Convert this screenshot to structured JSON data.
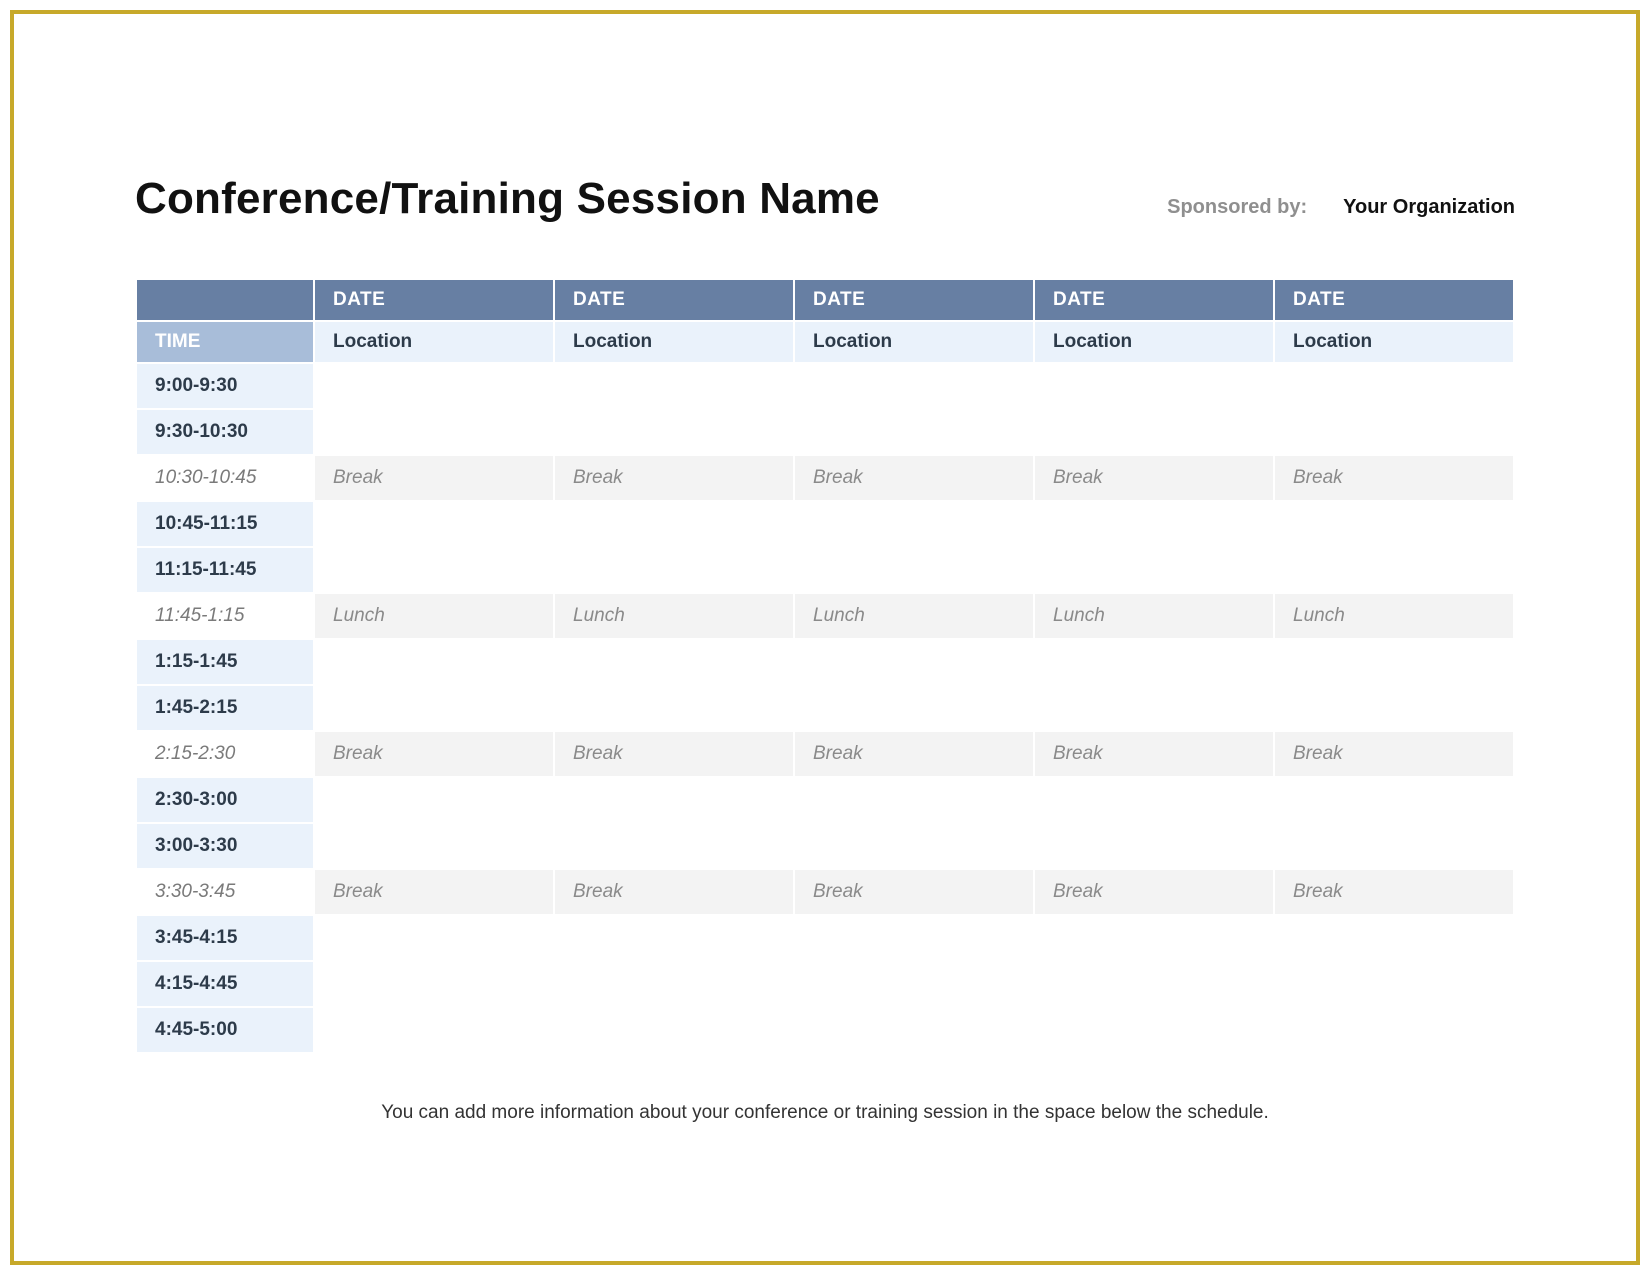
{
  "header": {
    "title": "Conference/Training Session Name",
    "sponsor_label": "Sponsored by:",
    "sponsor_org": "Your Organization"
  },
  "table": {
    "time_header": "TIME",
    "date_header": "DATE",
    "location_sub": "Location",
    "num_columns": 5,
    "rows": [
      {
        "time": "9:00-9:30",
        "type": "plain",
        "cells": [
          "",
          "",
          "",
          "",
          ""
        ]
      },
      {
        "time": "9:30-10:30",
        "type": "plain",
        "cells": [
          "",
          "",
          "",
          "",
          ""
        ]
      },
      {
        "time": "10:30-10:45",
        "type": "break",
        "cells": [
          "Break",
          "Break",
          "Break",
          "Break",
          "Break"
        ]
      },
      {
        "time": "10:45-11:15",
        "type": "plain",
        "cells": [
          "",
          "",
          "",
          "",
          ""
        ]
      },
      {
        "time": "11:15-11:45",
        "type": "plain",
        "cells": [
          "",
          "",
          "",
          "",
          ""
        ]
      },
      {
        "time": "11:45-1:15",
        "type": "break",
        "cells": [
          "Lunch",
          "Lunch",
          "Lunch",
          "Lunch",
          "Lunch"
        ]
      },
      {
        "time": "1:15-1:45",
        "type": "plain",
        "cells": [
          "",
          "",
          "",
          "",
          ""
        ]
      },
      {
        "time": "1:45-2:15",
        "type": "plain",
        "cells": [
          "",
          "",
          "",
          "",
          ""
        ]
      },
      {
        "time": "2:15-2:30",
        "type": "break",
        "cells": [
          "Break",
          "Break",
          "Break",
          "Break",
          "Break"
        ]
      },
      {
        "time": "2:30-3:00",
        "type": "plain",
        "cells": [
          "",
          "",
          "",
          "",
          ""
        ]
      },
      {
        "time": "3:00-3:30",
        "type": "plain",
        "cells": [
          "",
          "",
          "",
          "",
          ""
        ]
      },
      {
        "time": "3:30-3:45",
        "type": "break",
        "cells": [
          "Break",
          "Break",
          "Break",
          "Break",
          "Break"
        ]
      },
      {
        "time": "3:45-4:15",
        "type": "plain",
        "cells": [
          "",
          "",
          "",
          "",
          ""
        ]
      },
      {
        "time": "4:15-4:45",
        "type": "plain",
        "cells": [
          "",
          "",
          "",
          "",
          ""
        ]
      },
      {
        "time": "4:45-5:00",
        "type": "plain",
        "cells": [
          "",
          "",
          "",
          "",
          ""
        ]
      }
    ]
  },
  "footer": {
    "note": "You can add more information about your conference or training session in the space below the schedule."
  },
  "colors": {
    "frame": "#c7a92a",
    "header_band": "#677fa3",
    "time_header_bg": "#a8bdd9",
    "sub_header_bg": "#eaf2fb",
    "break_bg": "#f3f3f3"
  }
}
